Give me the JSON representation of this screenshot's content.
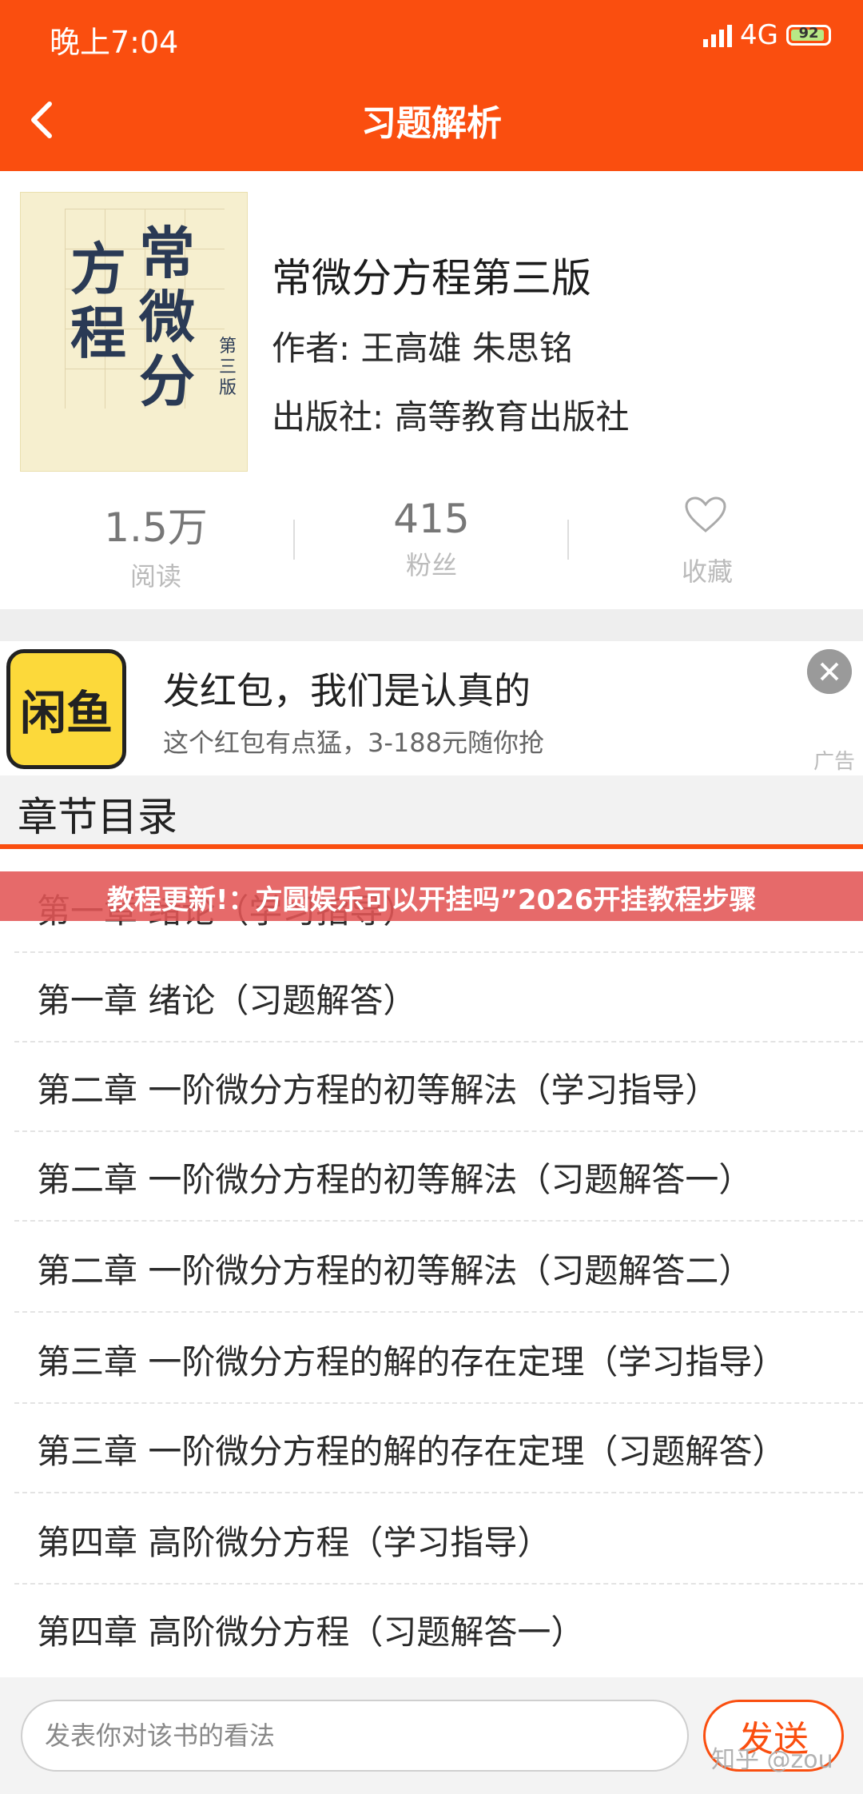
{
  "status": {
    "time": "晚上7:04",
    "network": "4G",
    "battery": "92"
  },
  "header": {
    "title": "习题解析"
  },
  "book": {
    "cover_chars": [
      "常",
      "微",
      "分",
      "方",
      "程"
    ],
    "cover_edition": "第三版",
    "title": "常微分方程第三版",
    "author": "作者: 王高雄 朱思铭",
    "publisher": "出版社: 高等教育出版社"
  },
  "stats": [
    {
      "value": "1.5万",
      "label": "阅读"
    },
    {
      "value": "415",
      "label": "粉丝"
    },
    {
      "label": "收藏",
      "icon": "heart-icon"
    }
  ],
  "ad": {
    "logo_text": "闲鱼",
    "title": "发红包，我们是认真的",
    "subtitle": "这个红包有点猛，3-188元随你抢",
    "tag": "广告"
  },
  "toc": {
    "title": "章节目录",
    "items": [
      "第一章 绪论（学习指导）",
      "第一章 绪论（习题解答）",
      "第二章 一阶微分方程的初等解法（学习指导）",
      "第二章 一阶微分方程的初等解法（习题解答一）",
      "第二章 一阶微分方程的初等解法（习题解答二）",
      "第三章 一阶微分方程的解的存在定理（学习指导）",
      "第三章 一阶微分方程的解的存在定理（习题解答）",
      "第四章 高阶微分方程（学习指导）",
      "第四章 高阶微分方程（习题解答一）"
    ]
  },
  "banner": {
    "text": "教程更新!：方圆娱乐可以开挂吗”2026开挂教程步骤"
  },
  "comment": {
    "placeholder": "发表你对该书的看法",
    "send_label": "发送"
  },
  "watermark": "知乎 @zou",
  "colors": {
    "accent": "#fa4e0f",
    "ad_logo": "#fcd93a"
  }
}
